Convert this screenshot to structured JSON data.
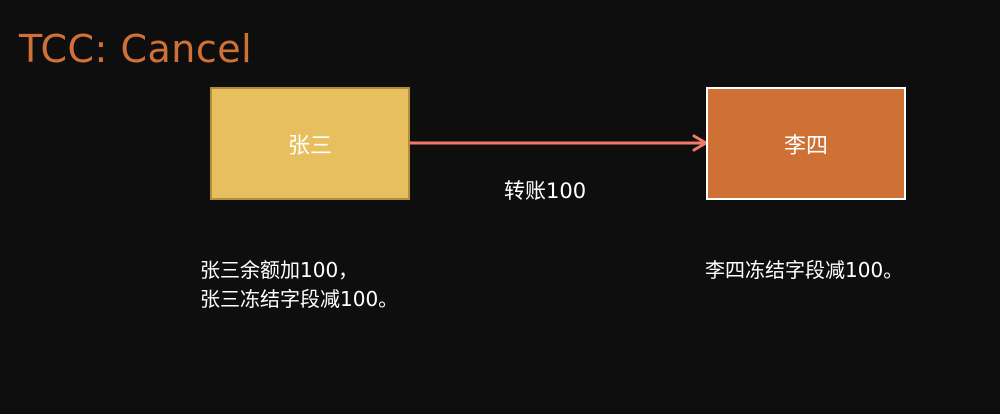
{
  "title": {
    "prefix": "TCC:",
    "suffix": " Cancel"
  },
  "nodes": {
    "left": {
      "label": "张三"
    },
    "right": {
      "label": "李四"
    }
  },
  "edge": {
    "label": "转账100"
  },
  "notes": {
    "left": [
      "张三余额加100，",
      "张三冻结字段减100。"
    ],
    "right": [
      "李四冻结字段减100。"
    ]
  },
  "colors": {
    "background": "#0f0e0e",
    "title": "#d07237",
    "left_node": "#e7bf5e",
    "right_node": "#cf7035",
    "arrow": "#f07a6a",
    "text": "#ffffff"
  }
}
